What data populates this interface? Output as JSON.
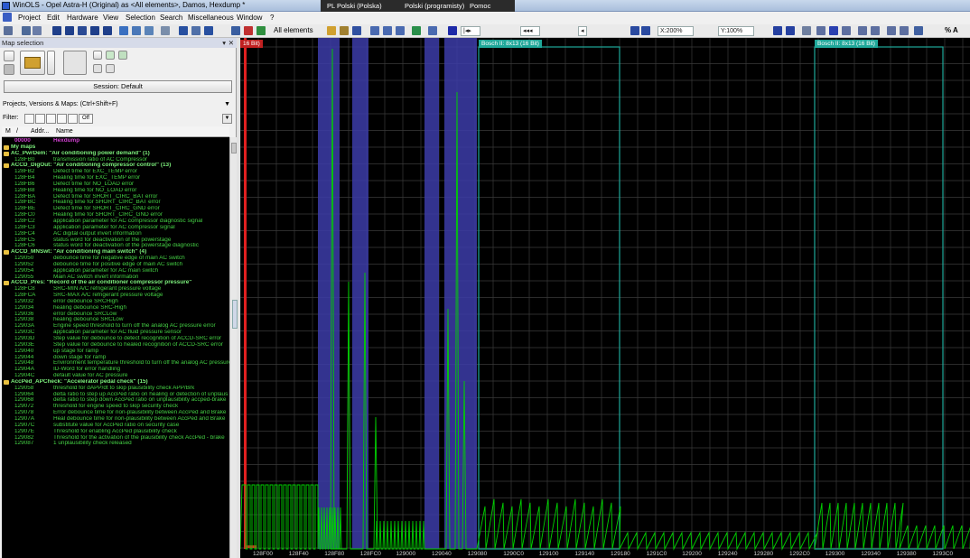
{
  "window": {
    "title": "WinOLS - Opel Astra-H (Original) as <All elements>, Damos, Hexdump *",
    "task_items": [
      "PL Polski (Polska)",
      "Polski (programisty)",
      "Pomoc"
    ]
  },
  "menu": [
    "Project",
    "Edit",
    "Hardware",
    "View",
    "Selection",
    "Search",
    "Miscellaneous",
    "Window",
    "?"
  ],
  "toolbar": {
    "filter_label": "All elements",
    "zoom_x": "X:200%",
    "zoom_y": "Y:100%",
    "right_label": "% A"
  },
  "left_panel": {
    "title": "Map selection",
    "session_button": "Session: Default",
    "projects_label": "Projects, Versions & Maps:  (Ctrl+Shift+F)",
    "filter_label": "Filter:",
    "filter_off": "Off",
    "list_headers": {
      "m": "M",
      "slash": "/",
      "addr": "Addr...",
      "name": "Name"
    },
    "rows": [
      {
        "type": "hex",
        "addr": "00000",
        "desc": "Hexdump"
      },
      {
        "type": "folder",
        "text": "My maps"
      },
      {
        "type": "folder",
        "text": "AC_PwrDem: \"Air conditioning power demand\" (1)"
      },
      {
        "type": "item",
        "addr": "128FB0",
        "desc": "transmission ratio of AC Compressor"
      },
      {
        "type": "folder",
        "text": "ACCD_DigOut: \"Air conditioning compressor control\" (13)"
      },
      {
        "type": "item",
        "addr": "128FB2",
        "desc": "Defect time for EXC_TEMP error"
      },
      {
        "type": "item",
        "addr": "128FB4",
        "desc": "Healing time for EXC_TEMP error"
      },
      {
        "type": "item",
        "addr": "128FB6",
        "desc": "Defect time for NO_LOAD error"
      },
      {
        "type": "item",
        "addr": "128FB8",
        "desc": "Healing time for NO_LOAD error"
      },
      {
        "type": "item",
        "addr": "128FBA",
        "desc": "Defect time for SHORT_CIRC_BAT error"
      },
      {
        "type": "item",
        "addr": "128FBC",
        "desc": "Healing time for SHORT_CIRC_BAT error"
      },
      {
        "type": "item",
        "addr": "128FBE",
        "desc": "Defect time for SHORT_CIRC_GND error"
      },
      {
        "type": "item",
        "addr": "128FC0",
        "desc": "Healing time for SHORT_CIRC_GND error"
      },
      {
        "type": "item",
        "addr": "128FC2",
        "desc": "application parameter for AC compressor diagnostic signal"
      },
      {
        "type": "item",
        "addr": "128FC3",
        "desc": "application parameter for AC compressor signal"
      },
      {
        "type": "item",
        "addr": "128FC4",
        "desc": "AC digital output invert information"
      },
      {
        "type": "item",
        "addr": "128FC5",
        "desc": "status word for deactivation of the powerstage"
      },
      {
        "type": "item",
        "addr": "128FC6",
        "desc": "status word for deactivation of the powerstage diagnostic"
      },
      {
        "type": "folder",
        "text": "ACCD_MNSwt: \"Air conditioning main switch\" (4)"
      },
      {
        "type": "item",
        "addr": "129050",
        "desc": "debounce time for negative edge of main AC switch"
      },
      {
        "type": "item",
        "addr": "129052",
        "desc": "debounce time for positive edge of main AC switch"
      },
      {
        "type": "item",
        "addr": "129054",
        "desc": "application parameter for AC main switch"
      },
      {
        "type": "item",
        "addr": "129055",
        "desc": "Main AC switch invert information"
      },
      {
        "type": "folder",
        "text": "ACCD_Pres: \"Record of the air conditioner compressor pressure\""
      },
      {
        "type": "item",
        "addr": "128FC8",
        "desc": "SRC-MIN A/C refrigerant pressure voltage"
      },
      {
        "type": "item",
        "addr": "128FCA",
        "desc": "SRC-MAX A/C refrigerant pressure voltage"
      },
      {
        "type": "item",
        "addr": "129032",
        "desc": "error debounce SRCHigh"
      },
      {
        "type": "item",
        "addr": "129034",
        "desc": "healing debounce SRC-High"
      },
      {
        "type": "item",
        "addr": "129036",
        "desc": "error debounce SRCLow"
      },
      {
        "type": "item",
        "addr": "129038",
        "desc": "healing debounce SRCLow"
      },
      {
        "type": "item",
        "addr": "12903A",
        "desc": "Engine speed threshold to turn off the analog AC pressure error"
      },
      {
        "type": "item",
        "addr": "12903C",
        "desc": "application parameter for AC fluid pressure sensor"
      },
      {
        "type": "item",
        "addr": "12903D",
        "desc": "Step value for debounce to detect recognition of ACCD-SRC error"
      },
      {
        "type": "item",
        "addr": "12903E",
        "desc": "Step value for debounce to healed recognition of ACCD-SRC error"
      },
      {
        "type": "item",
        "addr": "129040",
        "desc": "up stage for ramp"
      },
      {
        "type": "item",
        "addr": "129044",
        "desc": "down stage for ramp"
      },
      {
        "type": "item",
        "addr": "129048",
        "desc": "Environment temperature threshold to turn off the analog AC pressure"
      },
      {
        "type": "item",
        "addr": "12904A",
        "desc": "ID-Word for error handling"
      },
      {
        "type": "item",
        "addr": "12904C",
        "desc": "default value for AC pressure"
      },
      {
        "type": "folder",
        "text": "AccPed_APCheck: \"Accelerator pedal check\" (15)"
      },
      {
        "type": "item",
        "addr": "129058",
        "desc": "threshold for dAPP/dt to skip plausibility check APP/Brk"
      },
      {
        "type": "item",
        "addr": "129064",
        "desc": "delta ratio to step up AccPed ratio on healing or detection of unplaus"
      },
      {
        "type": "item",
        "addr": "129068",
        "desc": "delta ratio to step down AccPed ratio on unplausibility accped-brake"
      },
      {
        "type": "item",
        "addr": "129072",
        "desc": "threshold for engine speed to skip security check"
      },
      {
        "type": "item",
        "addr": "129078",
        "desc": "Error debounce time for non-plausibility between AccPed and Brake"
      },
      {
        "type": "item",
        "addr": "12907A",
        "desc": "Heal debounce time for non-plausibility between AccPed and Brake"
      },
      {
        "type": "item",
        "addr": "12907C",
        "desc": "substitute value for AccPed ratio on security case"
      },
      {
        "type": "item",
        "addr": "12907E",
        "desc": "Threshold for enabling AccPed plausibility check"
      },
      {
        "type": "item",
        "addr": "129082",
        "desc": "Threshold for the activation of the plausibility check AccPed - brake"
      },
      {
        "type": "item",
        "addr": "129087",
        "desc": "1 unplausibility check released"
      }
    ]
  },
  "graph": {
    "left_map_label": "16 Bit)",
    "map_labels": [
      "Bosch II: 8x13 (16 Bit)",
      "Bosch II: 8x13 (16 Bit)"
    ],
    "x_ticks": [
      "128F00",
      "128F40",
      "128F80",
      "128FC0",
      "129000",
      "129040",
      "129080",
      "1290C0",
      "129100",
      "129140",
      "129180",
      "1291C0",
      "129200",
      "129240",
      "129280",
      "1292C0",
      "129300",
      "129340",
      "129380",
      "1293C0"
    ],
    "colors": {
      "background": "#000000",
      "grid": "#3a3a3a",
      "signal": "#00d000",
      "selection": "#3c3ca8",
      "map_box": "#1fa89a",
      "marker": "#e02020"
    }
  }
}
